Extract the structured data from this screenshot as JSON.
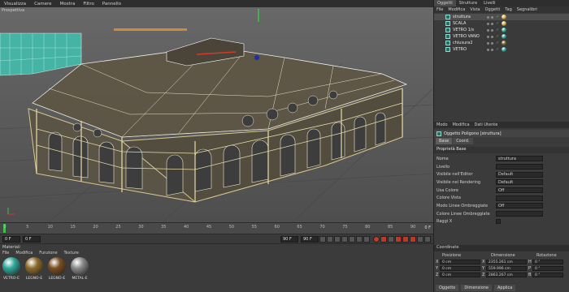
{
  "menubar": {
    "items": [
      "Visualizza",
      "Camere",
      "Mostra",
      "Filtro",
      "Pannello"
    ]
  },
  "viewport": {
    "label": "Prospettiva"
  },
  "timeline": {
    "ticks": [
      "0",
      "5",
      "10",
      "15",
      "20",
      "25",
      "30",
      "35",
      "40",
      "45",
      "50",
      "55",
      "60",
      "65",
      "70",
      "75",
      "80",
      "85",
      "90"
    ],
    "end_label": "0 F"
  },
  "transport": {
    "start_frame": "0 F",
    "current_frame": "0 F",
    "end_frame": "90 F",
    "max_frame": "90 F"
  },
  "materials": {
    "title": "Materiali",
    "menu": [
      "File",
      "Modifica",
      "Funzione",
      "Texture"
    ],
    "items": [
      {
        "name": "VETRO-E",
        "color": "#2fa89a"
      },
      {
        "name": "LEGNO-E",
        "color": "#8c6b2a"
      },
      {
        "name": "LEGNO-E",
        "color": "#7a4e22"
      },
      {
        "name": "METAL-E",
        "color": "#8a8a8a"
      }
    ]
  },
  "objects": {
    "tabs": [
      "Oggetti",
      "Strutture",
      "Livelli"
    ],
    "menu": [
      "File",
      "Modifica",
      "Vista",
      "Oggetti",
      "Tag",
      "Segnalibri"
    ],
    "rows": [
      {
        "name": "struttura",
        "tag_color": "#d9b24a"
      },
      {
        "name": "SCALA",
        "tag_color": "#d9b24a"
      },
      {
        "name": "VETRO 1/s",
        "tag_color": "#2fa89a"
      },
      {
        "name": "VETRO VANO",
        "tag_color": "#2fa89a"
      },
      {
        "name": "chiusura2",
        "tag_color": "#8c6b2a"
      },
      {
        "name": "VETRO",
        "tag_color": "#2fa89a"
      }
    ]
  },
  "attributes": {
    "menu": [
      "Modo",
      "Modifica",
      "Dati Utente"
    ],
    "title": "Oggetto Poligono [struttura]",
    "tabs": [
      "Base",
      "Coord."
    ],
    "section": "Proprietà Base",
    "rows": [
      {
        "label": "Nome",
        "value": "struttura"
      },
      {
        "label": "Livello",
        "value": ""
      },
      {
        "label": "Visibile nell'Editor",
        "value": "Default"
      },
      {
        "label": "Visibile nel Rendering",
        "value": "Default"
      },
      {
        "label": "Usa Colore",
        "value": "Off"
      },
      {
        "label": "Colore Vista",
        "value": ""
      },
      {
        "label": "Modo Linee Ombreggiate",
        "value": "Off"
      },
      {
        "label": "Colore Linee Ombreggiate",
        "value": ""
      },
      {
        "label": "Raggi X",
        "value": ""
      }
    ]
  },
  "coordinates": {
    "title": "Coordinate",
    "headers": [
      "Posizione",
      "Dimensione",
      "Rotazione"
    ],
    "rows": [
      {
        "axis": "X",
        "pos": "0 cm",
        "size": "2355.261 cm",
        "rot_axis": "H",
        "rot": "0 °"
      },
      {
        "axis": "Y",
        "pos": "0 cm",
        "size": "559.996 cm",
        "rot_axis": "P",
        "rot": "0 °"
      },
      {
        "axis": "Z",
        "pos": "0 cm",
        "size": "2863.267 cm",
        "rot_axis": "B",
        "rot": "0 °"
      }
    ],
    "buttons": [
      "Oggetto",
      "Dimensione",
      "Applica"
    ]
  }
}
